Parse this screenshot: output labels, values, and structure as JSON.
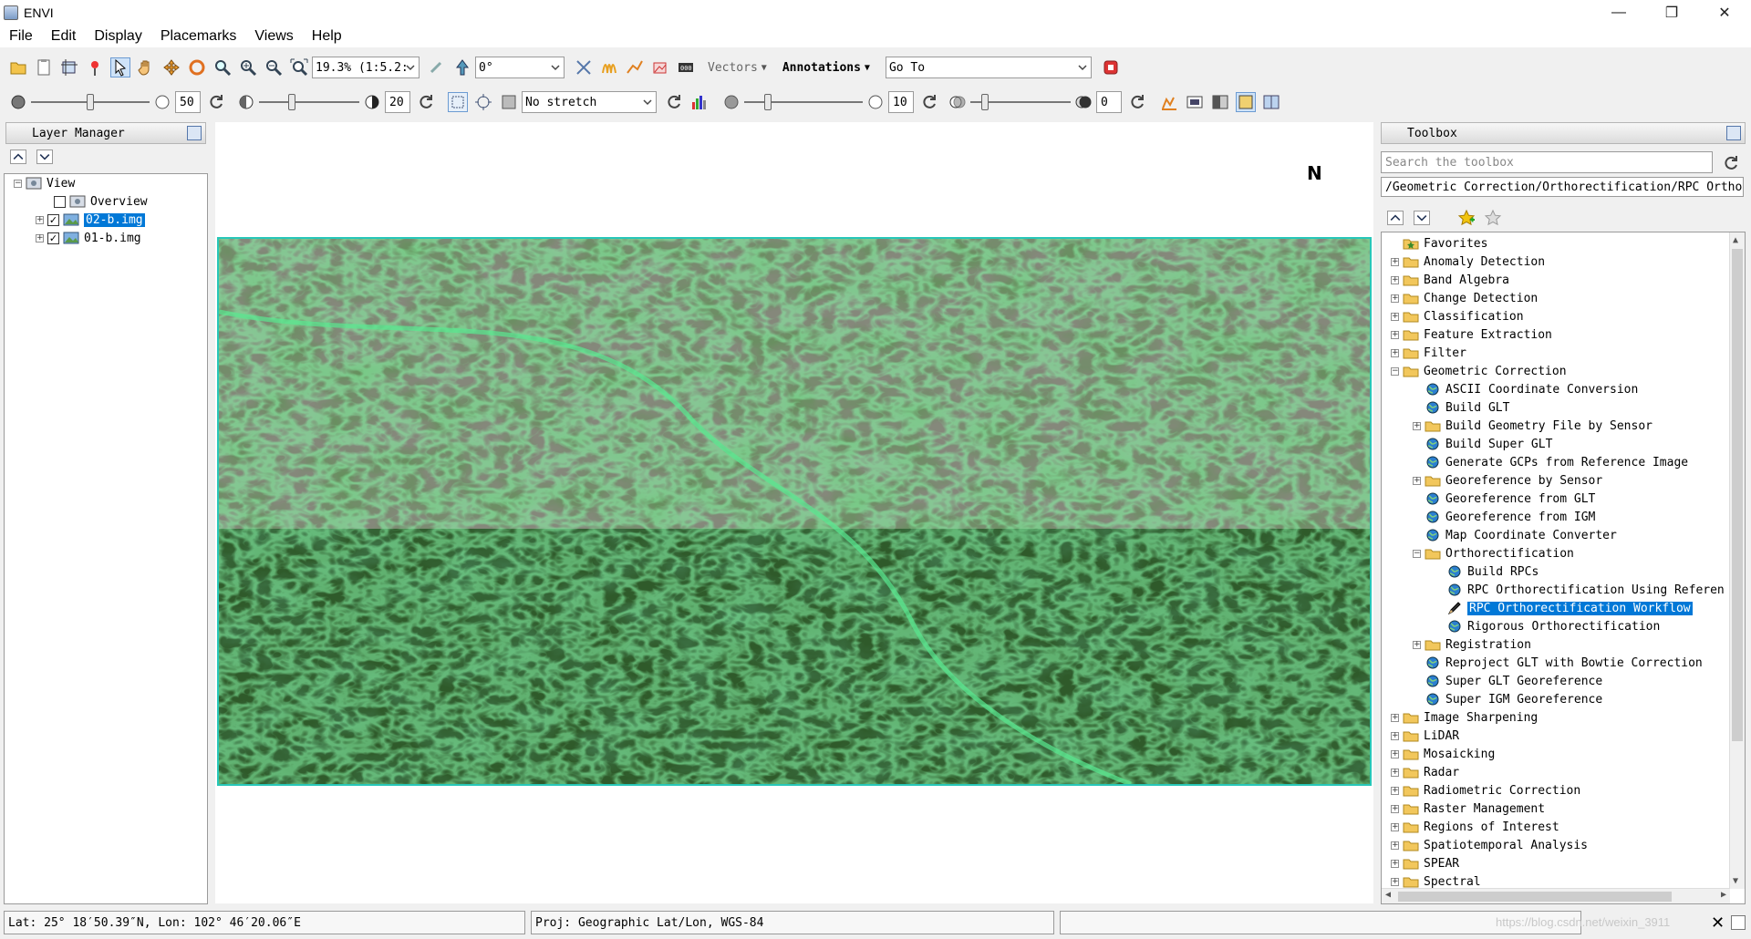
{
  "window": {
    "title": "ENVI",
    "controls": [
      "—",
      "❐",
      "✕"
    ]
  },
  "menu": [
    "File",
    "Edit",
    "Display",
    "Placemarks",
    "Views",
    "Help"
  ],
  "toolbar1": {
    "zoom_value": "19.3% (1:5.2:",
    "rotation_value": "0°",
    "vectors_label": "Vectors",
    "annotations_label": "Annotations",
    "goto_value": "Go To"
  },
  "toolbar2": {
    "brightness_value": "50",
    "contrast_value": "20",
    "stretch_value": "No stretch",
    "sharpen_value": "10",
    "transparency_value": "0"
  },
  "layer_manager": {
    "title": "Layer Manager",
    "root": "View",
    "items": [
      {
        "label": "Overview",
        "checked": false,
        "highlight": false
      },
      {
        "label": "02-b.img",
        "checked": true,
        "highlight": true
      },
      {
        "label": "01-b.img",
        "checked": true,
        "highlight": false
      }
    ]
  },
  "north_arrow": "N",
  "toolbox": {
    "title": "Toolbox",
    "search_placeholder": "Search the toolbox",
    "path": "/Geometric Correction/Orthorectification/RPC Orthore",
    "tree": [
      {
        "label": "Favorites",
        "level": 0,
        "type": "folder",
        "expander": ""
      },
      {
        "label": "Anomaly Detection",
        "level": 0,
        "type": "folder",
        "expander": "+"
      },
      {
        "label": "Band Algebra",
        "level": 0,
        "type": "folder",
        "expander": "+"
      },
      {
        "label": "Change Detection",
        "level": 0,
        "type": "folder",
        "expander": "+"
      },
      {
        "label": "Classification",
        "level": 0,
        "type": "folder",
        "expander": "+"
      },
      {
        "label": "Feature Extraction",
        "level": 0,
        "type": "folder",
        "expander": "+"
      },
      {
        "label": "Filter",
        "level": 0,
        "type": "folder",
        "expander": "+"
      },
      {
        "label": "Geometric Correction",
        "level": 0,
        "type": "folder",
        "expander": "−"
      },
      {
        "label": "ASCII Coordinate Conversion",
        "level": 1,
        "type": "tool",
        "expander": ""
      },
      {
        "label": "Build GLT",
        "level": 1,
        "type": "tool",
        "expander": ""
      },
      {
        "label": "Build Geometry File by Sensor",
        "level": 1,
        "type": "folder",
        "expander": "+"
      },
      {
        "label": "Build Super GLT",
        "level": 1,
        "type": "tool",
        "expander": ""
      },
      {
        "label": "Generate GCPs from Reference Image",
        "level": 1,
        "type": "tool",
        "expander": ""
      },
      {
        "label": "Georeference by Sensor",
        "level": 1,
        "type": "folder",
        "expander": "+"
      },
      {
        "label": "Georeference from GLT",
        "level": 1,
        "type": "tool",
        "expander": ""
      },
      {
        "label": "Georeference from IGM",
        "level": 1,
        "type": "tool",
        "expander": ""
      },
      {
        "label": "Map Coordinate Converter",
        "level": 1,
        "type": "tool",
        "expander": ""
      },
      {
        "label": "Orthorectification",
        "level": 1,
        "type": "folder",
        "expander": "−"
      },
      {
        "label": "Build RPCs",
        "level": 2,
        "type": "tool",
        "expander": ""
      },
      {
        "label": "RPC Orthorectification Using Referen",
        "level": 2,
        "type": "tool",
        "expander": ""
      },
      {
        "label": "RPC Orthorectification Workflow",
        "level": 2,
        "type": "workflow",
        "expander": "",
        "highlight": true
      },
      {
        "label": "Rigorous Orthorectification",
        "level": 2,
        "type": "tool",
        "expander": ""
      },
      {
        "label": "Registration",
        "level": 1,
        "type": "folder",
        "expander": "+"
      },
      {
        "label": "Reproject GLT with Bowtie Correction",
        "level": 1,
        "type": "tool",
        "expander": ""
      },
      {
        "label": "Super GLT Georeference",
        "level": 1,
        "type": "tool",
        "expander": ""
      },
      {
        "label": "Super IGM Georeference",
        "level": 1,
        "type": "tool",
        "expander": ""
      },
      {
        "label": "Image Sharpening",
        "level": 0,
        "type": "folder",
        "expander": "+"
      },
      {
        "label": "LiDAR",
        "level": 0,
        "type": "folder",
        "expander": "+"
      },
      {
        "label": "Mosaicking",
        "level": 0,
        "type": "folder",
        "expander": "+"
      },
      {
        "label": "Radar",
        "level": 0,
        "type": "folder",
        "expander": "+"
      },
      {
        "label": "Radiometric Correction",
        "level": 0,
        "type": "folder",
        "expander": "+"
      },
      {
        "label": "Raster Management",
        "level": 0,
        "type": "folder",
        "expander": "+"
      },
      {
        "label": "Regions of Interest",
        "level": 0,
        "type": "folder",
        "expander": "+"
      },
      {
        "label": "Spatiotemporal Analysis",
        "level": 0,
        "type": "folder",
        "expander": "+"
      },
      {
        "label": "SPEAR",
        "level": 0,
        "type": "folder",
        "expander": "+"
      },
      {
        "label": "Spectral",
        "level": 0,
        "type": "folder",
        "expander": "+"
      }
    ]
  },
  "status": {
    "coords": "Lat: 25° 18′50.39″N, Lon: 102° 46′20.06″E",
    "projection": "Proj: Geographic Lat/Lon, WGS-84",
    "watermark": "https://blog.csdn.net/weixin_3911"
  }
}
